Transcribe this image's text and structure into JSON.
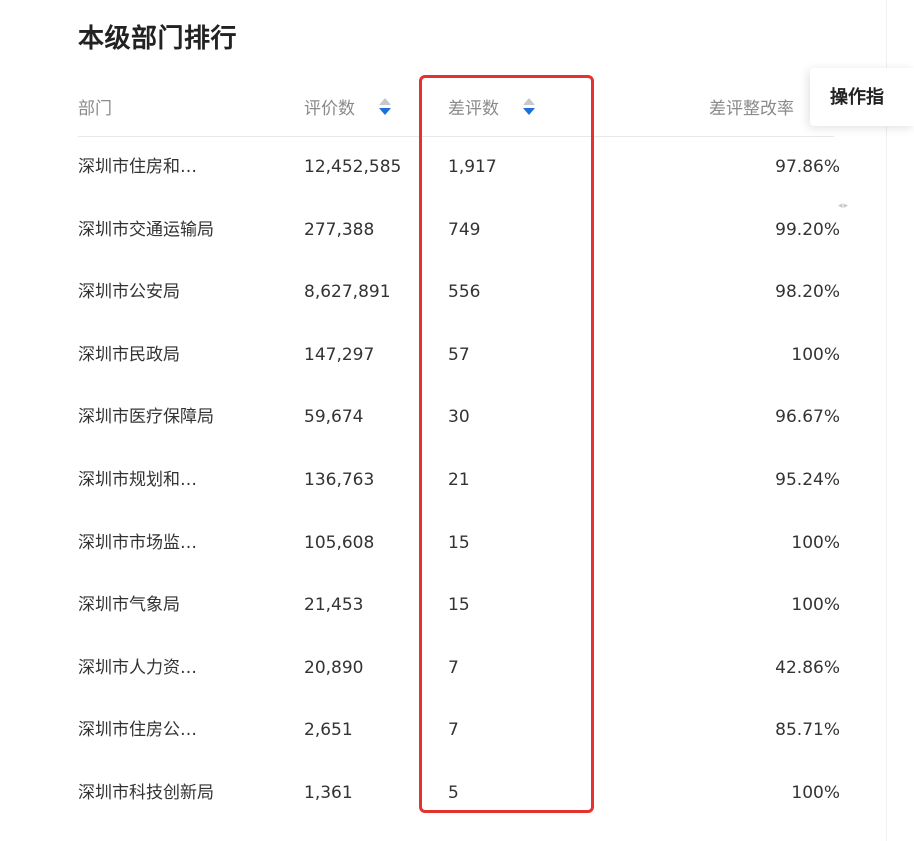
{
  "page_title": "本级部门排行",
  "columns": {
    "dept": "部门",
    "eval_count": "评价数",
    "bad_count": "差评数",
    "bad_fix_rate": "差评整改率"
  },
  "rows": [
    {
      "dept": "深圳市住房和…",
      "eval_count": "12,452,585",
      "bad_count": "1,917",
      "rate": "97.86%"
    },
    {
      "dept": "深圳市交通运输局",
      "eval_count": "277,388",
      "bad_count": "749",
      "rate": "99.20%"
    },
    {
      "dept": "深圳市公安局",
      "eval_count": "8,627,891",
      "bad_count": "556",
      "rate": "98.20%"
    },
    {
      "dept": "深圳市民政局",
      "eval_count": "147,297",
      "bad_count": "57",
      "rate": "100%"
    },
    {
      "dept": "深圳市医疗保障局",
      "eval_count": "59,674",
      "bad_count": "30",
      "rate": "96.67%"
    },
    {
      "dept": "深圳市规划和…",
      "eval_count": "136,763",
      "bad_count": "21",
      "rate": "95.24%"
    },
    {
      "dept": "深圳市市场监…",
      "eval_count": "105,608",
      "bad_count": "15",
      "rate": "100%"
    },
    {
      "dept": "深圳市气象局",
      "eval_count": "21,453",
      "bad_count": "15",
      "rate": "100%"
    },
    {
      "dept": "深圳市人力资…",
      "eval_count": "20,890",
      "bad_count": "7",
      "rate": "42.86%"
    },
    {
      "dept": "深圳市住房公…",
      "eval_count": "2,651",
      "bad_count": "7",
      "rate": "85.71%"
    },
    {
      "dept": "深圳市科技创新局",
      "eval_count": "1,361",
      "bad_count": "5",
      "rate": "100%"
    }
  ],
  "ops_tab": "操作指",
  "colors": {
    "highlight": "#e5322d",
    "sort_active": "#1e6fd9",
    "sort_inactive": "#c8c8c8",
    "header_text": "#8a8a8a"
  },
  "icons": {
    "sort": "sort-icon",
    "resize": "resize-handle-icon"
  }
}
